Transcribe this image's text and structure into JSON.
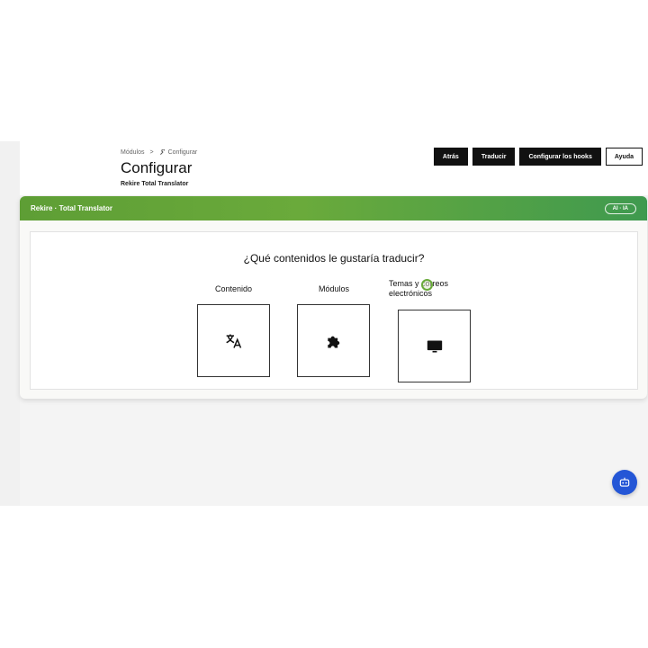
{
  "breadcrumb": {
    "parent": "Módulos",
    "separator": ">",
    "current": "Configurar",
    "current_icon": "wrench-icon"
  },
  "page": {
    "title": "Configurar",
    "subtitle": "Rekire Total Translator"
  },
  "toolbar": {
    "back_label": "Atrás",
    "translate_label": "Traducir",
    "hooks_label": "Configurar los hooks",
    "help_label": "Ayuda"
  },
  "panel": {
    "title": "Rekire · Total Translator",
    "badge": "AI · IA",
    "accent_color": "#5e9e35"
  },
  "main": {
    "question": "¿Qué contenidos le gustaría traducir?",
    "options": [
      {
        "label": "Contenido",
        "icon": "translate-icon"
      },
      {
        "label": "Módulos",
        "icon": "puzzle-icon"
      },
      {
        "label": "Temas y correos electrónicos",
        "icon": "monitor-icon"
      }
    ]
  },
  "chat": {
    "icon": "chat-bot-icon",
    "color": "#2456d6"
  }
}
